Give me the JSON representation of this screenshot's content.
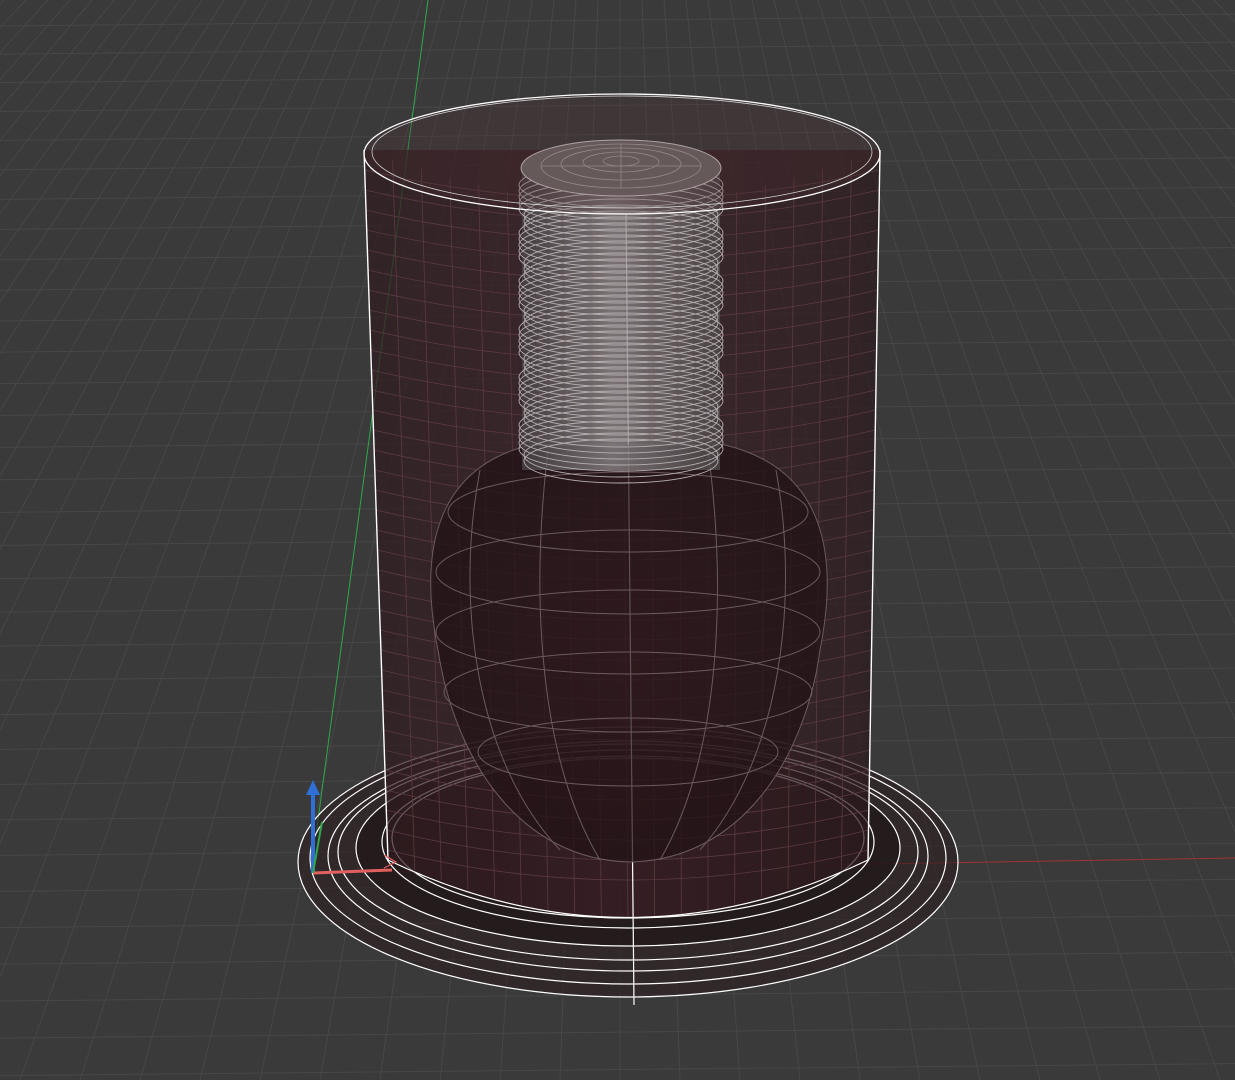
{
  "viewport": {
    "background": "#3a3a3a",
    "grid_color": "#474747"
  },
  "scene": {
    "objects": [
      "glass-cylinder",
      "bulb-base-thread",
      "bulb-glass",
      "base-plate"
    ],
    "wire_color": "#ffffff",
    "glass_tint": "#3a1b22",
    "thread_color": "#8a8a8a"
  },
  "axes": {
    "x_color": "#c0393b",
    "y_color": "#2ea84a",
    "z_color": "#2f6fd6"
  },
  "gizmo_icon": "axis-gizmo-icon"
}
